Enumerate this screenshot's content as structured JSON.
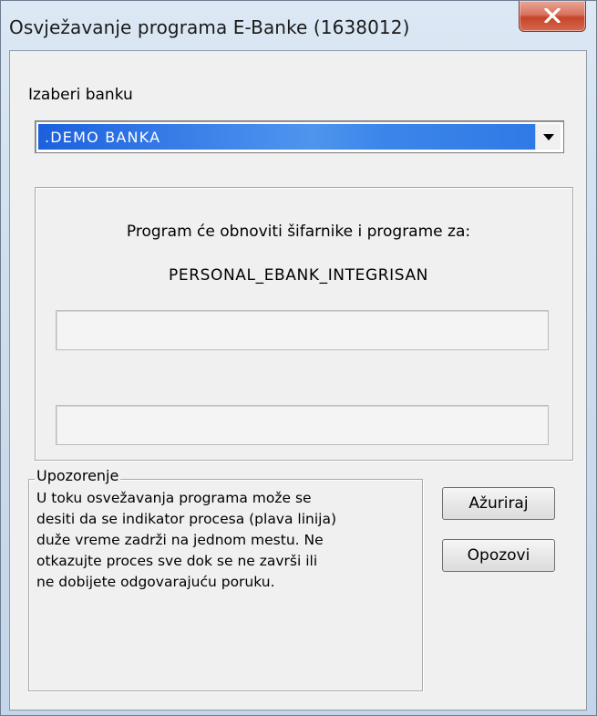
{
  "window": {
    "title": "Osvježavanje programa E-Banke (1638012)"
  },
  "bank_select": {
    "label": "Izaberi banku",
    "selected_value": ".DEMO BANKA",
    "dropdown_icon": "triangle-down"
  },
  "info": {
    "line1": "Program će obnoviti šifarnike i programe za:",
    "line2": "PERSONAL_EBANK_INTEGRISAN",
    "progress_primary": 0,
    "progress_secondary": 0
  },
  "warning": {
    "legend": "Upozorenje",
    "lines": [
      "U toku osvežavanja programa može se",
      "desiti da se indikator procesa (plava linija)",
      "duže vreme zadrži na jednom mestu. Ne",
      "otkazujte proces sve dok se ne završi ili",
      "ne dobijete odgovarajuću poruku."
    ]
  },
  "buttons": {
    "update_label": "Ažuriraj",
    "cancel_label": "Opozovi"
  },
  "colors": {
    "selection": "#3a7fe8",
    "close_button": "#c7432a"
  }
}
